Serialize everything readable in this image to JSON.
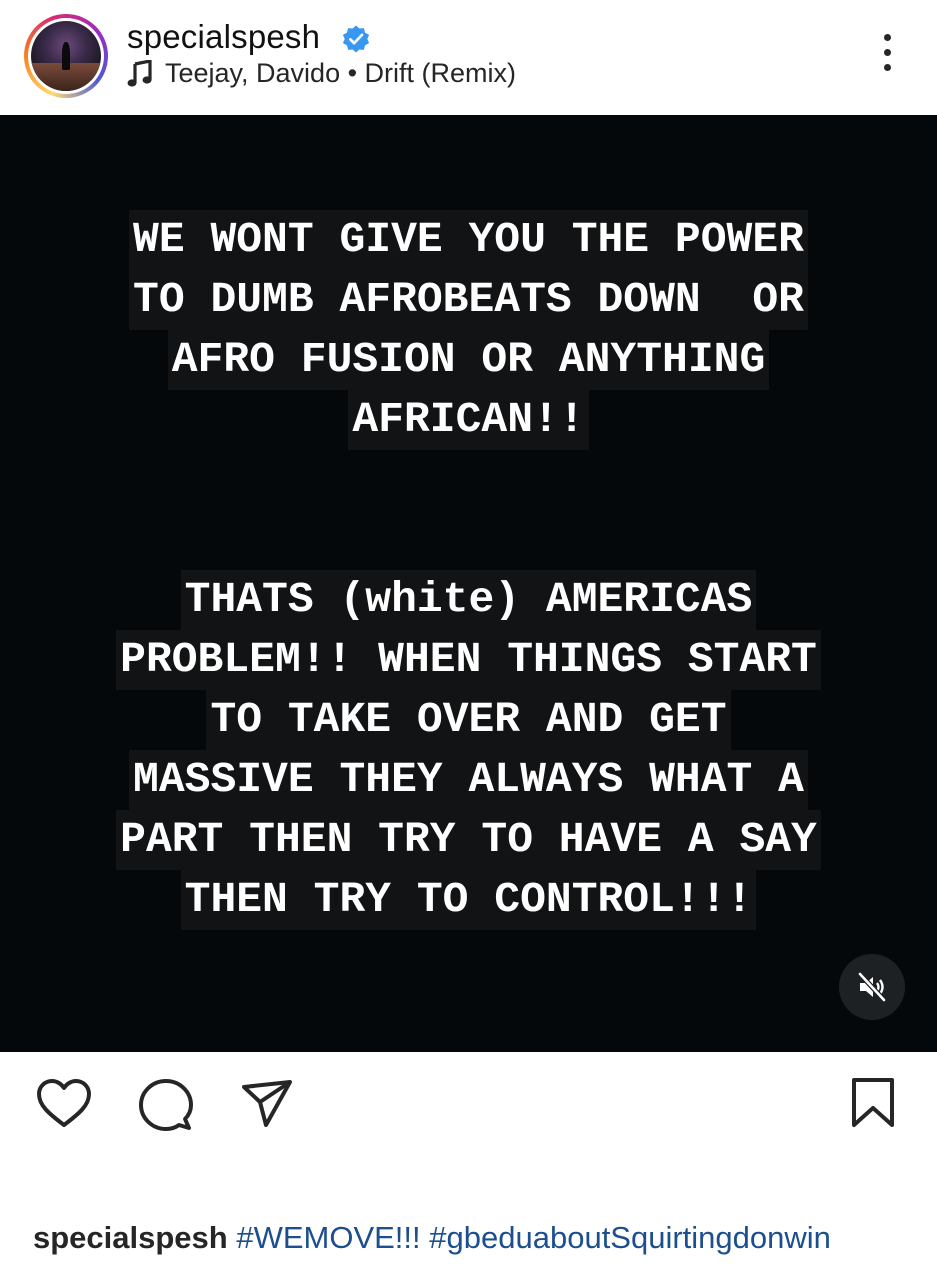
{
  "header": {
    "username": "specialspesh",
    "music": "Teejay, Davido • Drift (Remix)"
  },
  "post": {
    "block1": [
      "WE WONT GIVE YOU THE POWER",
      "TO DUMB AFROBEATS DOWN  OR",
      "AFRO FUSION OR ANYTHING",
      "AFRICAN!!"
    ],
    "block2": [
      "THATS (white) AMERICAS",
      "PROBLEM!! WHEN THINGS START",
      "TO TAKE OVER AND GET",
      "MASSIVE THEY ALWAYS WHAT A",
      "PART THEN TRY TO HAVE A SAY",
      "THEN TRY TO CONTROL!!!"
    ]
  },
  "caption": {
    "username": "specialspesh",
    "tag1": "#WEMOVE!!!",
    "tag2": "#gbeduaboutSquirtingdonwin"
  },
  "colors": {
    "verified": "#3897f0",
    "hashtag": "#1c4f8f",
    "media_bg": "#04080b"
  },
  "icons": [
    "verified-badge-icon",
    "music-note-icon",
    "more-options-icon",
    "mute-icon",
    "heart-icon",
    "comment-icon",
    "share-icon",
    "bookmark-icon"
  ]
}
